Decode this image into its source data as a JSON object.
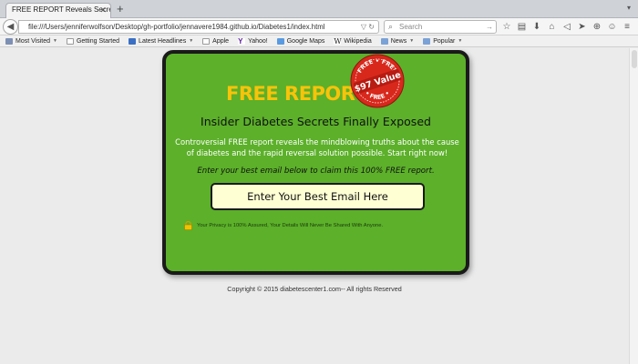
{
  "browser": {
    "tab_title": "FREE REPORT Reveals Secrets ...",
    "url": "file:///Users/jenniferwolfson/Desktop/gh-portfolio/jennavere1984.github.io/Diabetes1/index.html",
    "search_placeholder": "Search",
    "bookmarks": [
      {
        "label": "Most Visited",
        "icon": "gear-icon",
        "dropdown": true
      },
      {
        "label": "Getting Started",
        "icon": "page-icon",
        "dropdown": false
      },
      {
        "label": "Latest Headlines",
        "icon": "rss-icon",
        "dropdown": true
      },
      {
        "label": "Apple",
        "icon": "page-icon",
        "dropdown": false
      },
      {
        "label": "Yahoo!",
        "icon": "yahoo-icon",
        "dropdown": false
      },
      {
        "label": "Google Maps",
        "icon": "map-icon",
        "dropdown": false
      },
      {
        "label": "Wikipedia",
        "icon": "wikipedia-icon",
        "dropdown": false
      },
      {
        "label": "News",
        "icon": "folder-icon",
        "dropdown": true
      },
      {
        "label": "Popular",
        "icon": "folder-icon",
        "dropdown": true
      }
    ]
  },
  "optin": {
    "headline": "FREE REPORT:",
    "subhead": "Insider Diabetes Secrets Finally Exposed",
    "description": "Controversial FREE report reveals the mindblowing truths about the cause of diabetes and the rapid reversal solution possible.  Start right now!",
    "prompt": "Enter your best email below to claim this 100% FREE report.",
    "email_button": "Enter Your Best Email Here",
    "privacy": "Your Privacy is 100% Assured, Your Details Will Never Be Shared With Anyone.",
    "badge": {
      "top": "FREE • FREE",
      "value": "$97 Value",
      "bottom": "• FREE •"
    }
  },
  "footer": {
    "copyright": "Copyright © 2015 diabetescenter1.com-- All rights Reserved"
  },
  "colors": {
    "panel_green": "#5cb02a",
    "headline_gold": "#f8c30a",
    "badge_red": "#d8281c",
    "input_bg": "#ffffd4"
  }
}
